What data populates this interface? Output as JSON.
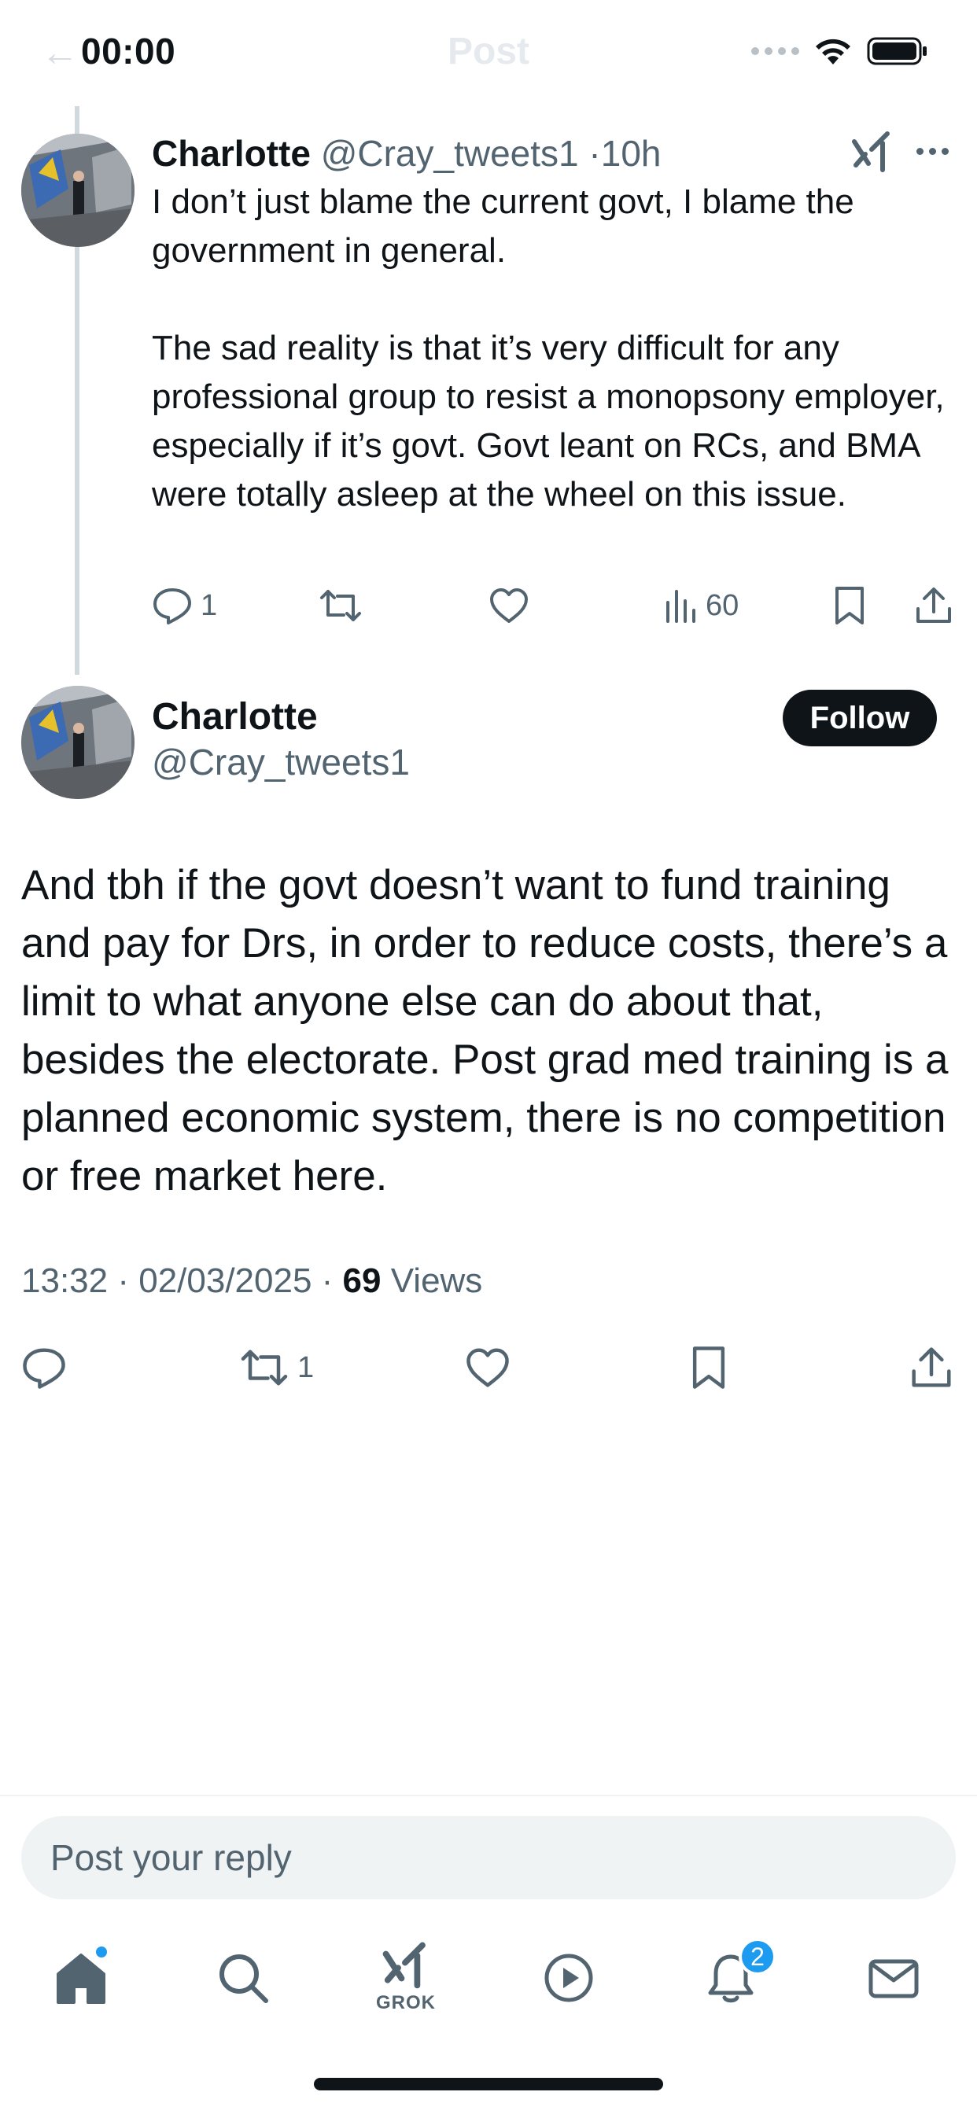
{
  "status_bar": {
    "time": "00:00"
  },
  "header": {
    "title": "Post"
  },
  "parent_post": {
    "name": "Charlotte",
    "handle": "@Cray_tweets1",
    "separator": "·",
    "age": "10h",
    "paragraphs": [
      "I don’t just blame the current govt, I blame the government in general.",
      "The sad reality is that it’s very difficult for any professional group to resist a monopsony employer, especially if it’s govt. Govt leant on RCs, and BMA were totally asleep at the wheel on this issue."
    ],
    "replies": "1",
    "views": "60"
  },
  "main_post": {
    "name": "Charlotte",
    "handle": "@Cray_tweets1",
    "follow_label": "Follow",
    "text": "And tbh if the govt doesn’t want to fund training and pay for Drs, in order to reduce costs, there’s a limit to what anyone else can do about that, besides the electorate. Post grad med training is a planned economic system, there is no competition or free market here.",
    "time": "13:32",
    "date": "02/03/2025",
    "views_count": "69",
    "views_label": "Views",
    "reposts": "1"
  },
  "reply": {
    "placeholder": "Post your reply"
  },
  "tabbar": {
    "grok_label": "GROK",
    "notifications_badge": "2"
  },
  "colors": {
    "accent": "#1d9bf0",
    "text": "#0f1419",
    "muted": "#536471",
    "reply_bg": "#eff3f4"
  }
}
